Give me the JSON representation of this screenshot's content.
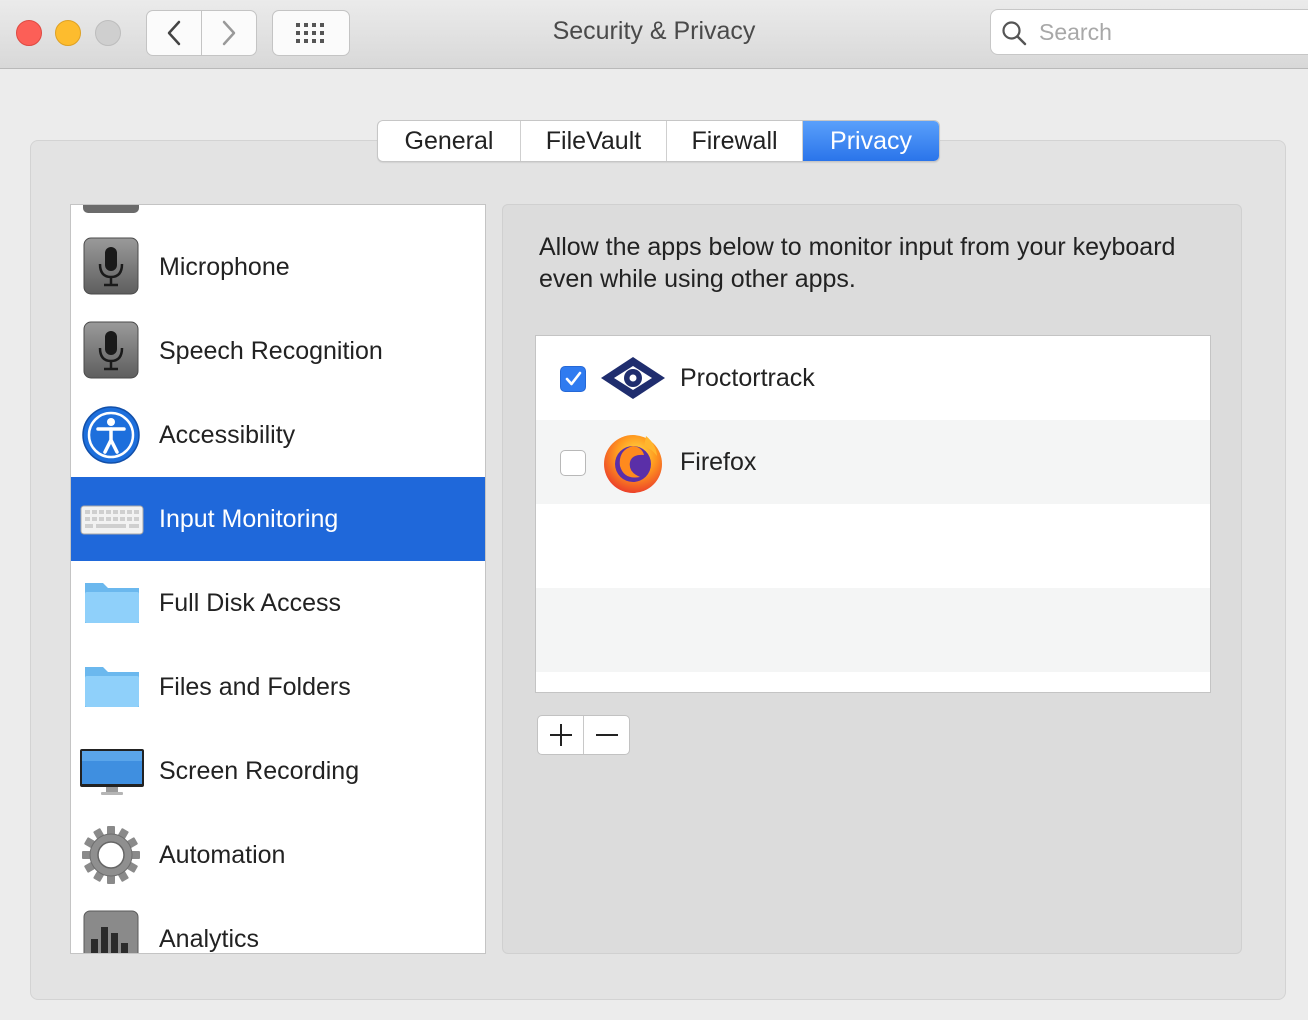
{
  "window": {
    "title": "Security & Privacy"
  },
  "search": {
    "placeholder": "Search",
    "value": ""
  },
  "tabs": [
    {
      "label": "General",
      "active": false
    },
    {
      "label": "FileVault",
      "active": false
    },
    {
      "label": "Firewall",
      "active": false
    },
    {
      "label": "Privacy",
      "active": true
    }
  ],
  "sidebar": {
    "items": [
      {
        "label": "Microphone",
        "icon": "microphone-icon",
        "selected": false
      },
      {
        "label": "Speech Recognition",
        "icon": "microphone-icon",
        "selected": false
      },
      {
        "label": "Accessibility",
        "icon": "accessibility-icon",
        "selected": false
      },
      {
        "label": "Input Monitoring",
        "icon": "keyboard-icon",
        "selected": true
      },
      {
        "label": "Full Disk Access",
        "icon": "folder-icon",
        "selected": false
      },
      {
        "label": "Files and Folders",
        "icon": "folder-icon",
        "selected": false
      },
      {
        "label": "Screen Recording",
        "icon": "monitor-icon",
        "selected": false
      },
      {
        "label": "Automation",
        "icon": "gear-icon",
        "selected": false
      },
      {
        "label": "Analytics",
        "icon": "analytics-icon",
        "selected": false
      }
    ]
  },
  "panel": {
    "description": "Allow the apps below to monitor input from your keyboard even while using other apps.",
    "apps": [
      {
        "name": "Proctortrack",
        "checked": true,
        "icon": "proctortrack-icon"
      },
      {
        "name": "Firefox",
        "checked": false,
        "icon": "firefox-icon"
      }
    ],
    "add_label": "+",
    "remove_label": "−"
  },
  "colors": {
    "accent": "#2a74ea",
    "selection": "#1f68da",
    "checkbox": "#2f7bf0"
  }
}
